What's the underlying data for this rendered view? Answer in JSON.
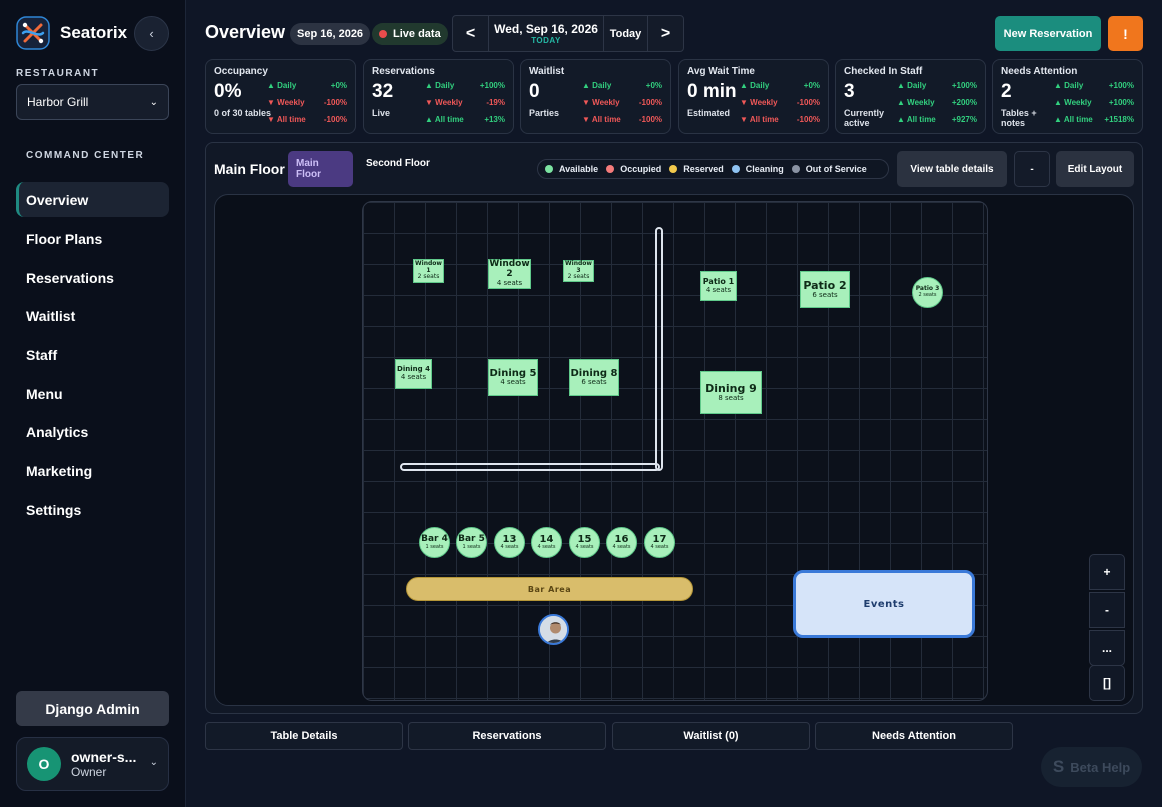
{
  "brand": {
    "name": "Seatorix"
  },
  "sidebar": {
    "restaurant_label": "RESTAURANT",
    "restaurant_value": "Harbor Grill",
    "section_label": "COMMAND CENTER",
    "items": [
      {
        "label": "Overview"
      },
      {
        "label": "Floor Plans"
      },
      {
        "label": "Reservations"
      },
      {
        "label": "Waitlist"
      },
      {
        "label": "Staff"
      },
      {
        "label": "Menu"
      },
      {
        "label": "Analytics"
      },
      {
        "label": "Marketing"
      },
      {
        "label": "Settings"
      }
    ],
    "django_label": "Django Admin",
    "user": {
      "initial": "O",
      "name": "owner-s...",
      "role": "Owner"
    }
  },
  "header": {
    "title": "Overview",
    "date_pill": "Sep 16, 2026",
    "live_label": "Live data",
    "prev": "<",
    "next": ">",
    "current_date": "Wed, Sep 16, 2026",
    "current_sub": "TODAY",
    "today": "Today",
    "new_reservation": "New Reservation",
    "alert": "!"
  },
  "cards": [
    {
      "title": "Occupancy",
      "value": "0%",
      "sub": "0 of 30 tables",
      "stats": [
        {
          "label": "Daily",
          "delta": "+0%",
          "dir": "up"
        },
        {
          "label": "Weekly",
          "delta": "-100%",
          "dir": "down"
        },
        {
          "label": "All time",
          "delta": "-100%",
          "dir": "down"
        }
      ]
    },
    {
      "title": "Reservations",
      "value": "32",
      "sub": "Live",
      "stats": [
        {
          "label": "Daily",
          "delta": "+100%",
          "dir": "up"
        },
        {
          "label": "Weekly",
          "delta": "-19%",
          "dir": "down"
        },
        {
          "label": "All time",
          "delta": "+13%",
          "dir": "up"
        }
      ]
    },
    {
      "title": "Waitlist",
      "value": "0",
      "sub": "Parties",
      "stats": [
        {
          "label": "Daily",
          "delta": "+0%",
          "dir": "up"
        },
        {
          "label": "Weekly",
          "delta": "-100%",
          "dir": "down"
        },
        {
          "label": "All time",
          "delta": "-100%",
          "dir": "down"
        }
      ]
    },
    {
      "title": "Avg Wait Time",
      "value": "0 min",
      "sub": "Estimated",
      "stats": [
        {
          "label": "Daily",
          "delta": "+0%",
          "dir": "up"
        },
        {
          "label": "Weekly",
          "delta": "-100%",
          "dir": "down"
        },
        {
          "label": "All time",
          "delta": "-100%",
          "dir": "down"
        }
      ]
    },
    {
      "title": "Checked In Staff",
      "value": "3",
      "sub": "Currently active",
      "stats": [
        {
          "label": "Daily",
          "delta": "+100%",
          "dir": "up"
        },
        {
          "label": "Weekly",
          "delta": "+200%",
          "dir": "up"
        },
        {
          "label": "All time",
          "delta": "+927%",
          "dir": "up"
        }
      ]
    },
    {
      "title": "Needs Attention",
      "value": "2",
      "sub": "Tables + notes",
      "stats": [
        {
          "label": "Daily",
          "delta": "+100%",
          "dir": "up"
        },
        {
          "label": "Weekly",
          "delta": "+100%",
          "dir": "up"
        },
        {
          "label": "All time",
          "delta": "+1518%",
          "dir": "up"
        }
      ]
    }
  ],
  "floor": {
    "title": "Main Floor",
    "tabs": [
      "Main Floor",
      "Second Floor"
    ],
    "legend": [
      {
        "label": "Available",
        "color": "#7ce3a1"
      },
      {
        "label": "Occupied",
        "color": "#f47b7b"
      },
      {
        "label": "Reserved",
        "color": "#f2c94c"
      },
      {
        "label": "Cleaning",
        "color": "#8fc3f2"
      },
      {
        "label": "Out of Service",
        "color": "#8a93a3"
      }
    ],
    "view_details": "View table details",
    "dash": "-",
    "edit_layout": "Edit Layout",
    "tables": [
      {
        "name": "Window 1",
        "seats": "2 seats"
      },
      {
        "name": "Window 2",
        "seats": "4 seats"
      },
      {
        "name": "Window 3",
        "seats": "2 seats"
      },
      {
        "name": "Patio 1",
        "seats": "4 seats"
      },
      {
        "name": "Patio 2",
        "seats": "6 seats"
      },
      {
        "name": "Patio 3",
        "seats": "2 seats"
      },
      {
        "name": "Dining 4",
        "seats": "4 seats"
      },
      {
        "name": "Dining 5",
        "seats": "4 seats"
      },
      {
        "name": "Dining 8",
        "seats": "6 seats"
      },
      {
        "name": "Dining 9",
        "seats": "8 seats"
      },
      {
        "name": "Bar 4",
        "seats": "1 seats"
      },
      {
        "name": "Bar 5",
        "seats": "1 seats"
      },
      {
        "name": "13",
        "seats": "4 seats"
      },
      {
        "name": "14",
        "seats": "4 seats"
      },
      {
        "name": "15",
        "seats": "4 seats"
      },
      {
        "name": "16",
        "seats": "4 seats"
      },
      {
        "name": "17",
        "seats": "4 seats"
      }
    ],
    "bar_area": "Bar Area",
    "events": "Events",
    "zoom_in": "+",
    "zoom_out": "-",
    "more": "...",
    "fit": "[]"
  },
  "bottom_tabs": [
    "Table Details",
    "Reservations",
    "Waitlist (0)",
    "Needs Attention"
  ],
  "beta_help": {
    "icon": "S",
    "label": "Beta Help"
  }
}
